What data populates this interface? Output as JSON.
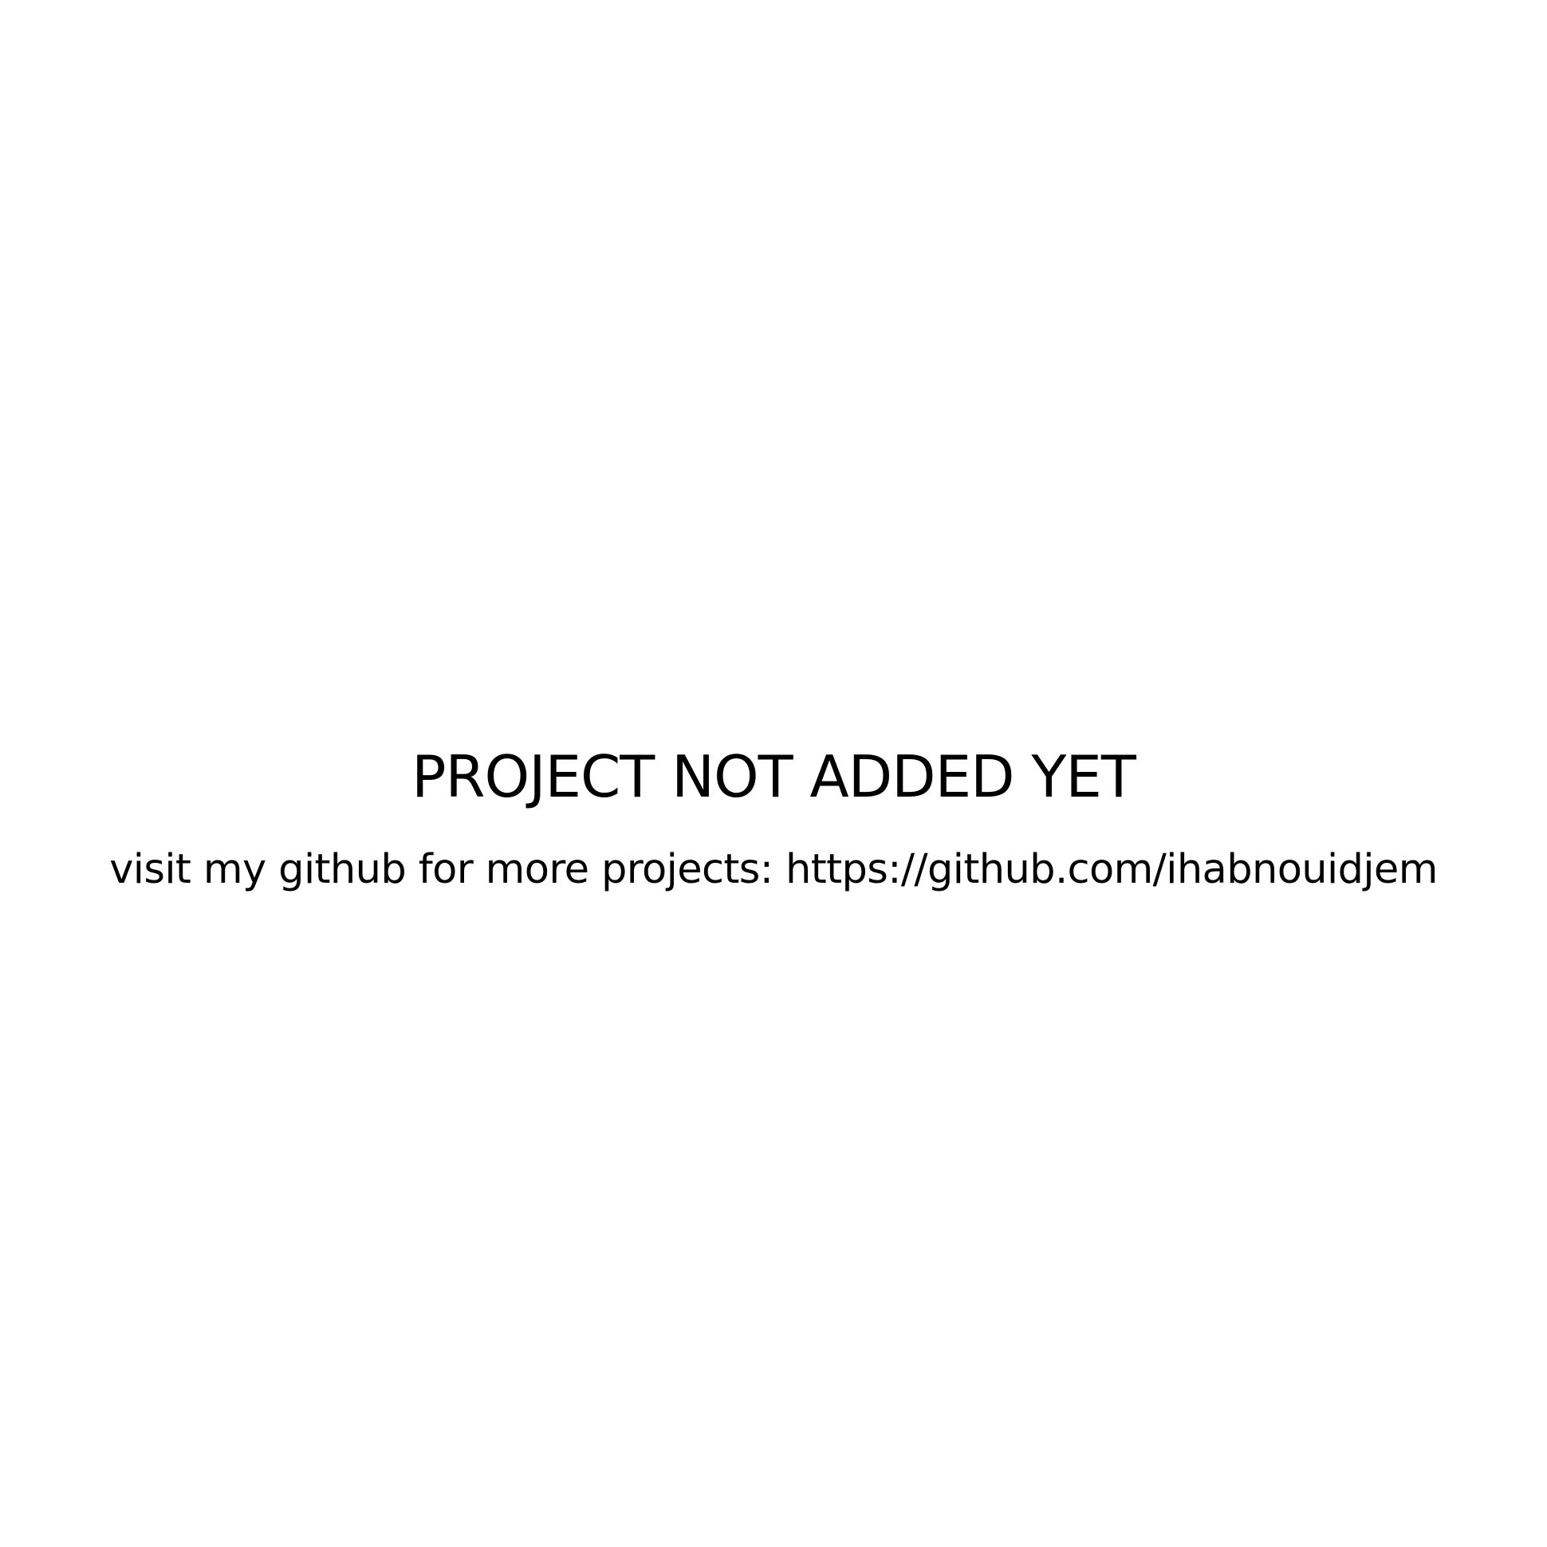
{
  "message": {
    "title": "PROJECT NOT ADDED YET",
    "subtitle": "visit my github for more projects: https://github.com/ihabnouidjem"
  },
  "colors": {
    "background": "#ffffff",
    "text": "#000000"
  }
}
